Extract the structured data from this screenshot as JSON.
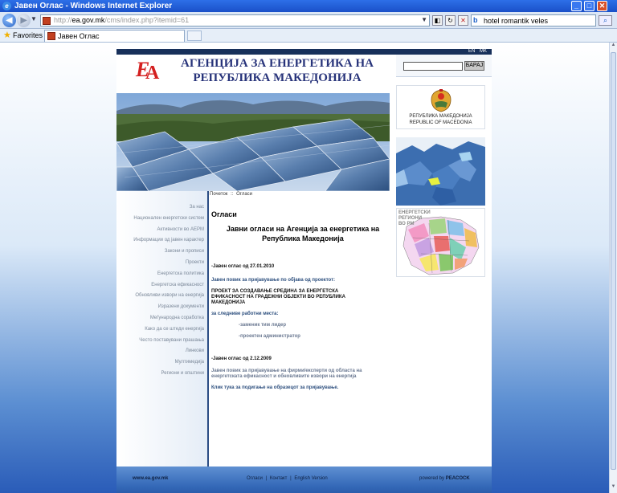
{
  "window": {
    "title": "Јавен Оглас - Windows Internet Explorer"
  },
  "addressbar": {
    "url_prefix": "http://",
    "url_host": "ea.gov.mk",
    "url_path": "/cms/index.php?itemid=61",
    "search_value": "hotel romantik veles"
  },
  "favorites": {
    "label": "Favorites",
    "tab_title": "Јавен Оглас"
  },
  "site": {
    "lang_en": "EN",
    "lang_mk": "MK",
    "agency_title_line1": "АГЕНЦИЈА ЗА ЕНЕРГЕТИКА НА",
    "agency_title_line2": "РЕПУБЛИКА МАКЕДОНИЈА",
    "search_button": "БАРАЈ",
    "coat_caption_mk": "РЕПУБЛИКА МАКЕДОНИЈА",
    "coat_caption_en": "REPUBLIC OF MACEDONIA",
    "map_caption": "ЕНЕРГЕТСКИ РЕГИОНИ ВО РМ",
    "breadcrumb": {
      "home": "Почеток",
      "separator": "::",
      "current": "Огласи"
    },
    "nav": [
      "За нас",
      "Национален енергетски систем",
      "Активности во АЕРМ",
      "Информации од јавен карактер",
      "Закони и прописи",
      "Проекти",
      "Енергетска политика",
      "Енергетска ефикасност",
      "Обновливи извори на енергија",
      "Изразени документи",
      "Меѓународна соработка",
      "Како да се штеди енергија",
      "Често поставувани прашања",
      "Линкови",
      "Мултимедија",
      "Региони и општини"
    ],
    "content": {
      "heading": "Огласи",
      "news_title": "Јавни огласи на Агенција за енергетика на Република Македонија",
      "ad1_date": "-Јавен оглас од 27.01.2010",
      "ad1_call": "Јавен повик за пријавување по објава од проектот:",
      "ad1_project": "ПРОЕКТ ЗА СОЗДАВАЊЕ СРЕДИНА ЗА ЕНЕРГЕТСКА ЕФИКАСНОСТ НА ГРАДЕЖНИ ОБЈЕКТИ ВО РЕПУБЛИКА МАКЕДОНИЈА",
      "ad1_positions_label": "за следниве работни места:",
      "ad1_position1": "-заменик тим лидер",
      "ad1_position2": "-проектен администратор",
      "ad2_date": "-Јавен оглас од 2.12.2009",
      "ad2_text": "Јавен повик за пријавување на фирми/експерти од областа на енергетската ефикасност и обновливите извори на енергија",
      "ad2_link": "Клик тука за подигање на образецот за пријавување."
    },
    "footer": {
      "domain": "www.ea.gov.mk",
      "link1": "Огласи",
      "link2": "Контакт",
      "link3": "English Version",
      "separator": "|",
      "powered_prefix": "powered by",
      "powered_name": "PEACOCK"
    }
  },
  "colors": {
    "title_blue": "#27337a",
    "logo_red": "#d42020",
    "nav_border": "#2a4c84",
    "page_bg": "#2a5db4"
  }
}
